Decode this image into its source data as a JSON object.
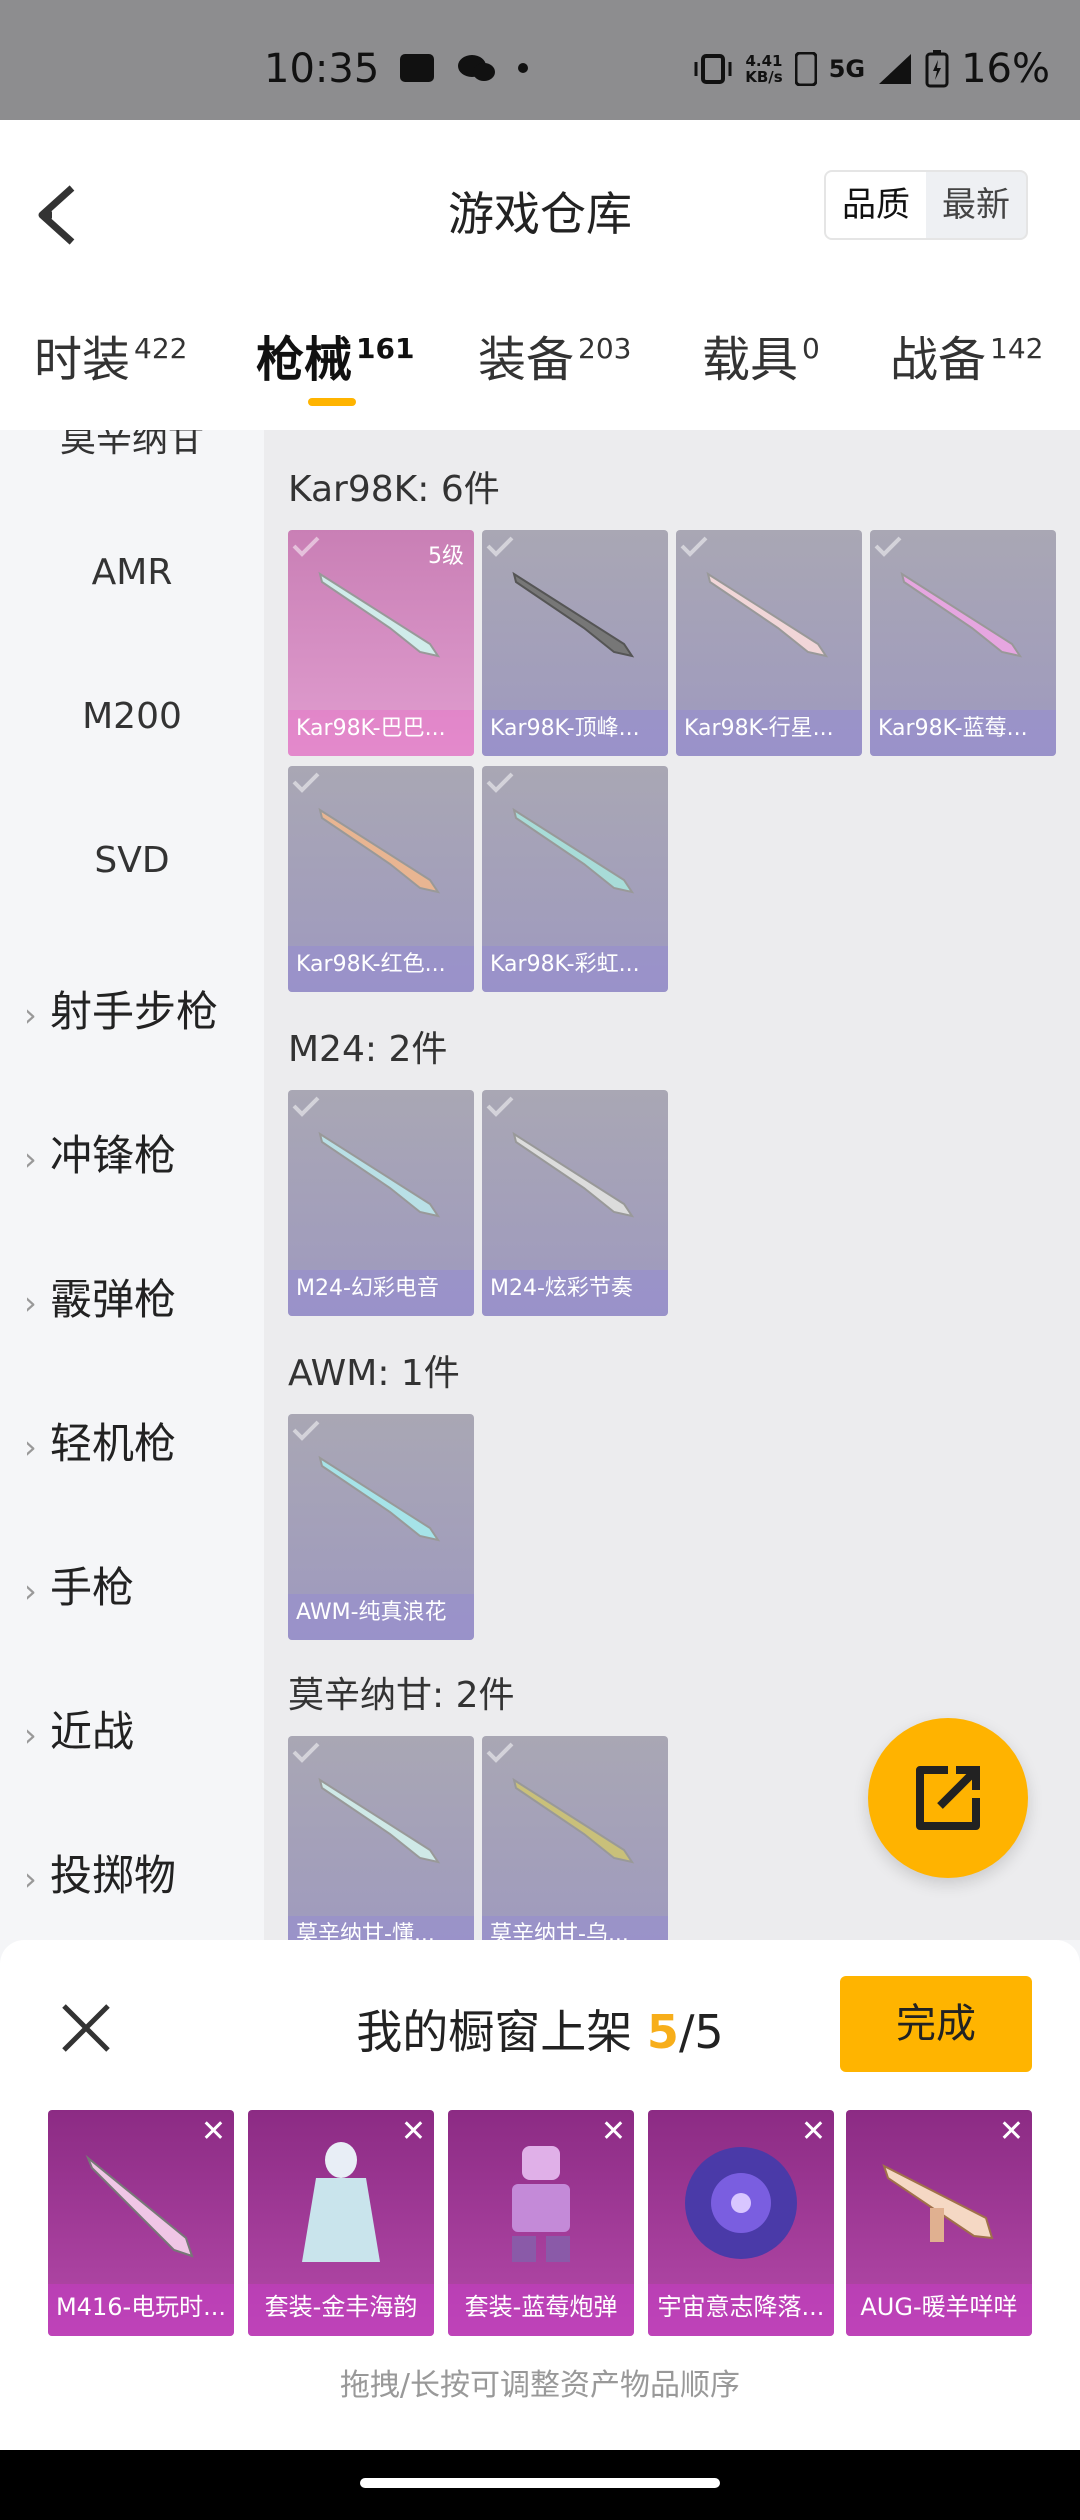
{
  "status": {
    "time": "10:35",
    "net_speed_top": "4.41",
    "net_speed_bottom": "KB/s",
    "network": "5G",
    "battery": "16%"
  },
  "header": {
    "title": "游戏仓库",
    "sort_quality": "品质",
    "sort_newest": "最新"
  },
  "tabs": [
    {
      "label": "时装",
      "count": "422"
    },
    {
      "label": "枪械",
      "count": "161"
    },
    {
      "label": "装备",
      "count": "203"
    },
    {
      "label": "载具",
      "count": "0"
    },
    {
      "label": "战备",
      "count": "142"
    }
  ],
  "sidebar": {
    "partial_top": "莫辛纳甘",
    "subitems": [
      "AMR",
      "M200",
      "SVD"
    ],
    "categories": [
      "射手步枪",
      "冲锋枪",
      "霰弹枪",
      "轻机枪",
      "手枪",
      "近战",
      "投掷物"
    ]
  },
  "sections": [
    {
      "title": "Kar98K: 6件",
      "items": [
        {
          "label": "Kar98K-巴巴...",
          "level": "5级",
          "tier": "pink"
        },
        {
          "label": "Kar98K-顶峰..."
        },
        {
          "label": "Kar98K-行星..."
        },
        {
          "label": "Kar98K-蓝莓..."
        },
        {
          "label": "Kar98K-红色..."
        },
        {
          "label": "Kar98K-彩虹..."
        }
      ]
    },
    {
      "title": "M24: 2件",
      "items": [
        {
          "label": "M24-幻彩电音"
        },
        {
          "label": "M24-炫彩节奏"
        }
      ]
    },
    {
      "title": "AWM: 1件",
      "items": [
        {
          "label": "AWM-纯真浪花"
        }
      ]
    },
    {
      "title": "莫辛纳甘: 2件",
      "items": [
        {
          "label": "莫辛纳甘-懂..."
        },
        {
          "label": "莫辛纳甘-乌..."
        }
      ]
    }
  ],
  "showcase": {
    "title_prefix": "我的橱窗上架",
    "count": "5",
    "total": "/5",
    "done_label": "完成",
    "hint": "拖拽/长按可调整资产物品顺序",
    "items": [
      {
        "label": "M416-电玩时..."
      },
      {
        "label": "套装-金丰海韵"
      },
      {
        "label": "套装-蓝莓炮弹"
      },
      {
        "label": "宇宙意志降落..."
      },
      {
        "label": "AUG-暖羊咩咩"
      }
    ]
  },
  "colors": {
    "accent": "#ffb400",
    "card_purple": "#a09bc0",
    "card_pink": "#e19ed0",
    "showcase_purple": "#a23d98"
  }
}
